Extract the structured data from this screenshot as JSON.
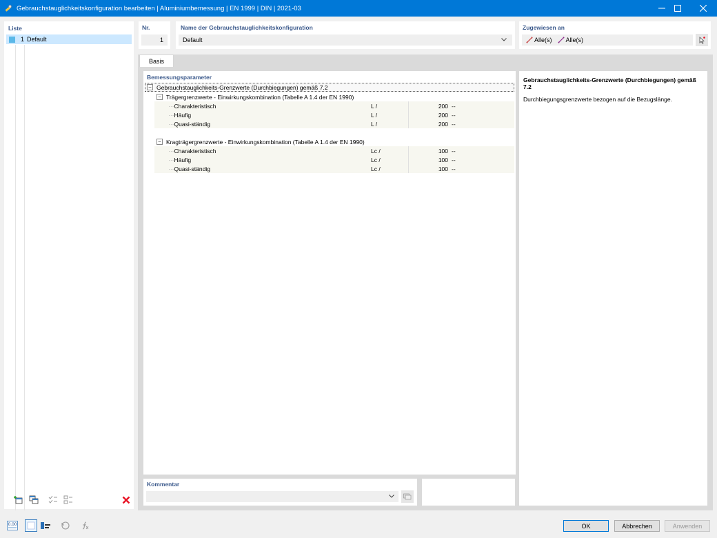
{
  "window": {
    "title": "Gebrauchstauglichkeitskonfiguration bearbeiten | Aluminiumbemessung | EN 1999 | DIN | 2021-03"
  },
  "list": {
    "header": "Liste",
    "items": [
      {
        "nr": "1",
        "label": "Default",
        "color": "#5bb8e8"
      }
    ]
  },
  "nr": {
    "label": "Nr.",
    "value": "1"
  },
  "name": {
    "label": "Name der Gebrauchstauglichkeitskonfiguration",
    "value": "Default"
  },
  "assigned": {
    "label": "Zugewiesen an",
    "members": "Alle(s)",
    "member_sets": "Alle(s)"
  },
  "tabs": [
    {
      "label": "Basis",
      "active": true
    }
  ],
  "params": {
    "header": "Bemessungsparameter",
    "root": "Gebrauchstauglichkeits-Grenzwerte (Durchbiegungen) gemäß 7.2",
    "groups": [
      {
        "label": "Trägergrenzwerte - Einwirkungskombination (Tabelle A 1.4 der EN 1990)",
        "rows": [
          {
            "label": "Charakteristisch",
            "symbol": "L /",
            "value": "200",
            "unit": "--"
          },
          {
            "label": "Häufig",
            "symbol": "L /",
            "value": "200",
            "unit": "--"
          },
          {
            "label": "Quasi-ständig",
            "symbol": "L /",
            "value": "200",
            "unit": "--"
          }
        ]
      },
      {
        "label": "Kragträgergrenzwerte - Einwirkungskombination (Tabelle A 1.4 der EN 1990)",
        "rows": [
          {
            "label": "Charakteristisch",
            "symbol": "Lc /",
            "value": "100",
            "unit": "--"
          },
          {
            "label": "Häufig",
            "symbol": "Lc /",
            "value": "100",
            "unit": "--"
          },
          {
            "label": "Quasi-ständig",
            "symbol": "Lc /",
            "value": "100",
            "unit": "--"
          }
        ]
      }
    ]
  },
  "help": {
    "title": "Gebrauchstauglichkeits-Grenzwerte (Durchbiegungen) gemäß 7.2",
    "text": "Durchbiegungsgrenzwerte bezogen auf die Bezugslänge."
  },
  "comment": {
    "label": "Kommentar",
    "value": ""
  },
  "bottom_tools": {
    "decimals_label": "0.00"
  },
  "buttons": {
    "ok": "OK",
    "cancel": "Abbrechen",
    "apply": "Anwenden"
  },
  "colors": {
    "titlebar": "#0078d7",
    "selection": "#cce8ff",
    "accent_label": "#3c5a8c",
    "delete": "#e81123"
  }
}
